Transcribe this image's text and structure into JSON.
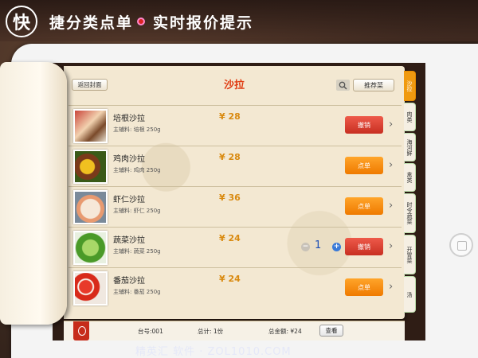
{
  "banner": {
    "logo_char": "快",
    "text_left": "捷分类点单",
    "text_right": "实时报价提示"
  },
  "menu": {
    "back_label": "返回封面",
    "title": "沙拉",
    "recommend_label": "推荐菜",
    "items": [
      {
        "name": "培根沙拉",
        "sub": "主辅料: 培根 250g",
        "price": "¥ 28",
        "button": "撤销",
        "state": "cancel"
      },
      {
        "name": "鸡肉沙拉",
        "sub": "主辅料: 鸡肉 250g",
        "price": "¥ 28",
        "button": "点单",
        "state": "order"
      },
      {
        "name": "虾仁沙拉",
        "sub": "主辅料: 虾仁 250g",
        "price": "¥ 36",
        "button": "点单",
        "state": "order"
      },
      {
        "name": "蔬菜沙拉",
        "sub": "主辅料: 蔬菜 250g",
        "price": "¥ 24",
        "button": "撤销",
        "state": "cancel",
        "qty": "1"
      },
      {
        "name": "番茄沙拉",
        "sub": "主辅料: 番茄 250g",
        "price": "¥ 24",
        "button": "点单",
        "state": "order"
      }
    ]
  },
  "tabs": [
    "沙拉",
    "肉类",
    "海河鲜",
    "禽类",
    "时令蔬菜",
    "开胃菜",
    "汤"
  ],
  "footer": {
    "table_no": "台号:001",
    "total_count": "总计: 1份",
    "total_amount": "总金额: ¥24",
    "view_label": "查看"
  },
  "watermark": "精英汇 软件 · ZOL1010.COM",
  "colors": {
    "title": "#e03a10",
    "price": "#d98a10",
    "order_btn": "#f08a00",
    "cancel_btn": "#d23a2c",
    "active_tab": "#f09a10"
  }
}
